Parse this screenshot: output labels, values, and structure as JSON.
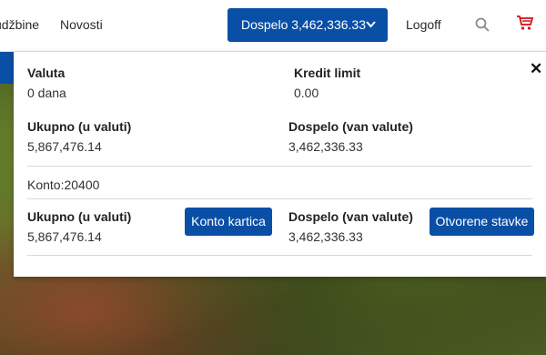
{
  "nav": {
    "orders": "udžbine",
    "news": "Novosti",
    "due_button": "Dospelo 3,462,336.33",
    "logoff": "Logoff"
  },
  "icons": {
    "search": "search-icon",
    "cart": "cart-icon",
    "close": "close-icon",
    "chevron": "chevron-down-icon"
  },
  "colors": {
    "primary": "#0a4fa6",
    "cart": "#d0101a"
  },
  "panel": {
    "close_glyph": "✕",
    "currency_label": "Valuta",
    "currency_value": "0 dana",
    "credit_label": "Kredit limit",
    "credit_value": "0.00",
    "total_label": "Ukupno (u valuti)",
    "total_value": "5,867,476.14",
    "due_label": "Dospelo (van valute)",
    "due_value": "3,462,336.33",
    "account": "Konto:20400",
    "account_total_label": "Ukupno (u valuti)",
    "account_total_value": "5,867,476.14",
    "account_card_button": "Konto kartica",
    "account_due_label": "Dospelo (van valute)",
    "account_due_value": "3,462,336.33",
    "open_items_button": "Otvorene stavke"
  }
}
